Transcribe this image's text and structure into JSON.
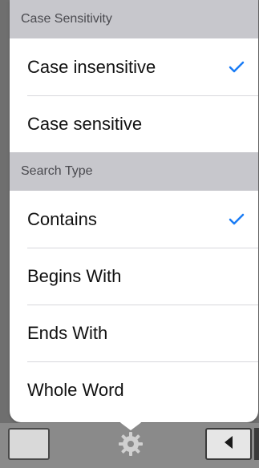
{
  "popover": {
    "sections": [
      {
        "header": "Case Sensitivity",
        "options": [
          {
            "label": "Case insensitive",
            "selected": true
          },
          {
            "label": "Case sensitive",
            "selected": false
          }
        ]
      },
      {
        "header": "Search Type",
        "options": [
          {
            "label": "Contains",
            "selected": true
          },
          {
            "label": "Begins With",
            "selected": false
          },
          {
            "label": "Ends With",
            "selected": false
          },
          {
            "label": "Whole Word",
            "selected": false
          }
        ]
      }
    ]
  },
  "colors": {
    "check": "#1a7cf5",
    "section_header_bg": "#c7c7cc",
    "toolbar_bg": "#8a8a8a"
  },
  "icons": {
    "checkmark": "checkmark-icon",
    "gear": "gear-icon",
    "back": "back-triangle-icon"
  }
}
